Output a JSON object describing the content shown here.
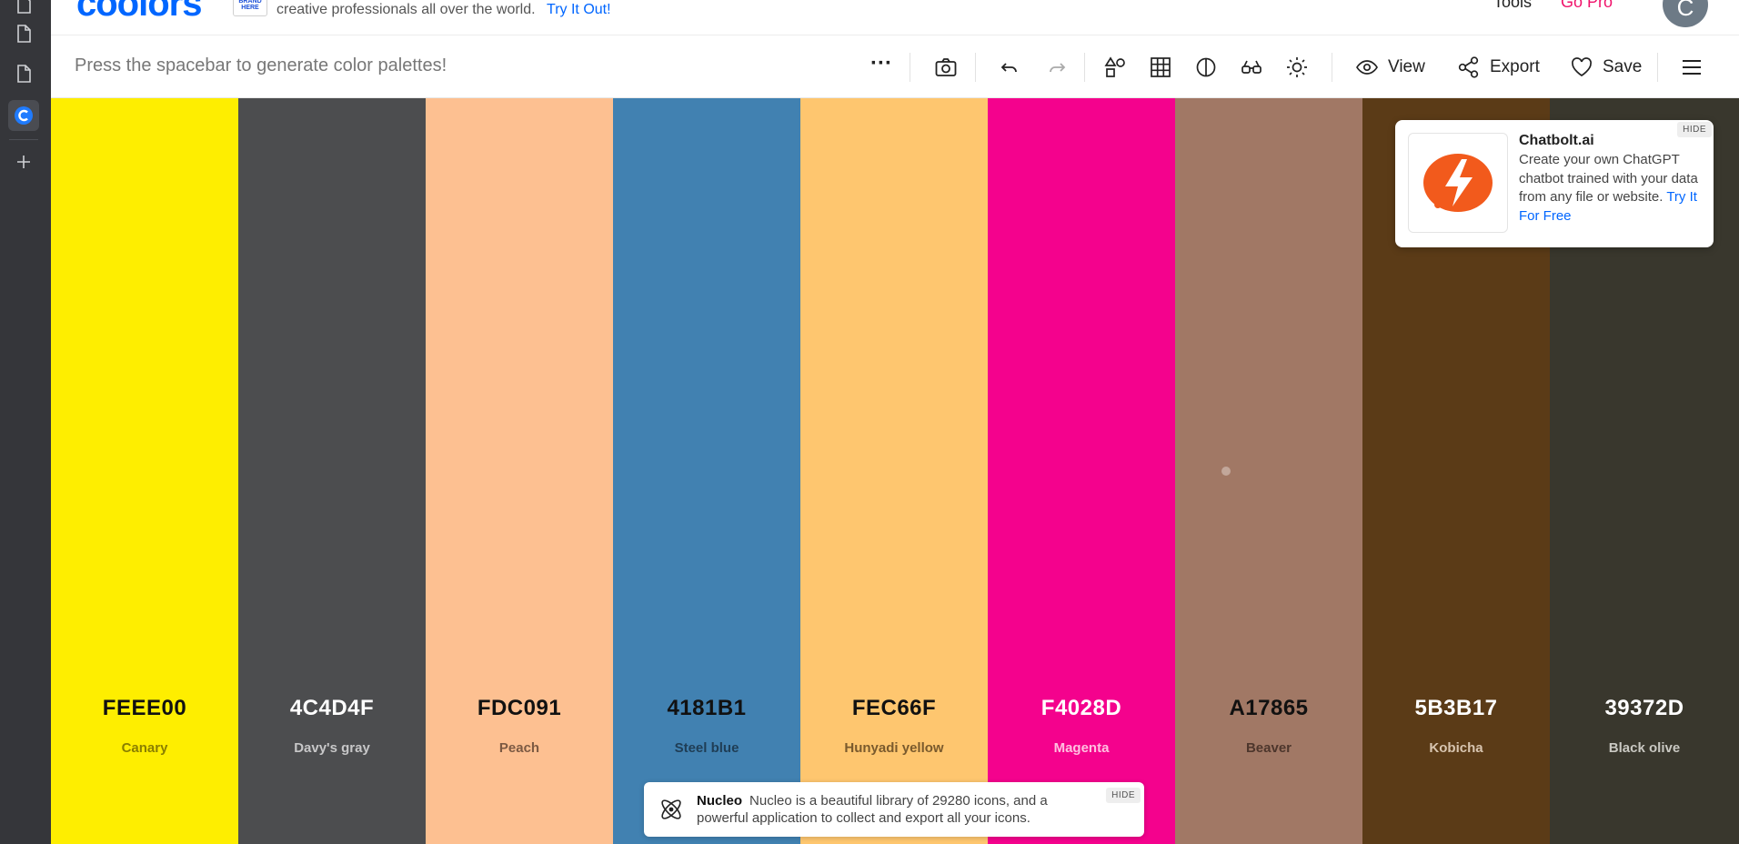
{
  "header": {
    "logo_text": "coolors",
    "ad_badge": "BRAND HERE",
    "ad_text": "creative professionals all over the world.",
    "ad_link": "Try It Out!",
    "nav_tools": "Tools",
    "nav_gopro": "Go Pro",
    "avatar_initial": "C"
  },
  "toolbar": {
    "hint": "Press the spacebar to generate color palettes!",
    "more_label": "···",
    "view_label": "View",
    "export_label": "Export",
    "save_label": "Save"
  },
  "palette": [
    {
      "hex": "FEEE00",
      "name": "Canary",
      "color": "#FEEE00",
      "text": "#111111",
      "sub": "#8a7f00"
    },
    {
      "hex": "4C4D4F",
      "name": "Davy's gray",
      "color": "#4C4D4F",
      "text": "#ffffff",
      "sub": "#c7c7c8"
    },
    {
      "hex": "FDC091",
      "name": "Peach",
      "color": "#FDC091",
      "text": "#111111",
      "sub": "#7c5a43"
    },
    {
      "hex": "4181B1",
      "name": "Steel blue",
      "color": "#4181B1",
      "text": "#111111",
      "sub": "#1f3d55"
    },
    {
      "hex": "FEC66F",
      "name": "Hunyadi yellow",
      "color": "#FEC66F",
      "text": "#111111",
      "sub": "#7a5a2d"
    },
    {
      "hex": "F4028D",
      "name": "Magenta",
      "color": "#F4028D",
      "text": "#ffffff",
      "sub": "#ffc0e0"
    },
    {
      "hex": "A17865",
      "name": "Beaver",
      "color": "#A17865",
      "text": "#111111",
      "sub": "#4d362c"
    },
    {
      "hex": "5B3B17",
      "name": "Kobicha",
      "color": "#5B3B17",
      "text": "#ffffff",
      "sub": "#d8c5b0"
    },
    {
      "hex": "39372D",
      "name": "Black olive",
      "color": "#39372D",
      "text": "#ffffff",
      "sub": "#c9c8c2"
    }
  ],
  "chatbolt_ad": {
    "title": "Chatbolt.ai",
    "body": "Create your own ChatGPT chatbot trained with your data from any file or website.",
    "link": "Try It For Free",
    "hide_label": "HIDE",
    "accent": "#f25a1c"
  },
  "nucleo_ad": {
    "title": "Nucleo",
    "body": "Nucleo is a beautiful library of 29280 icons, and a powerful application to collect and export all your icons.",
    "hide_label": "HIDE"
  }
}
